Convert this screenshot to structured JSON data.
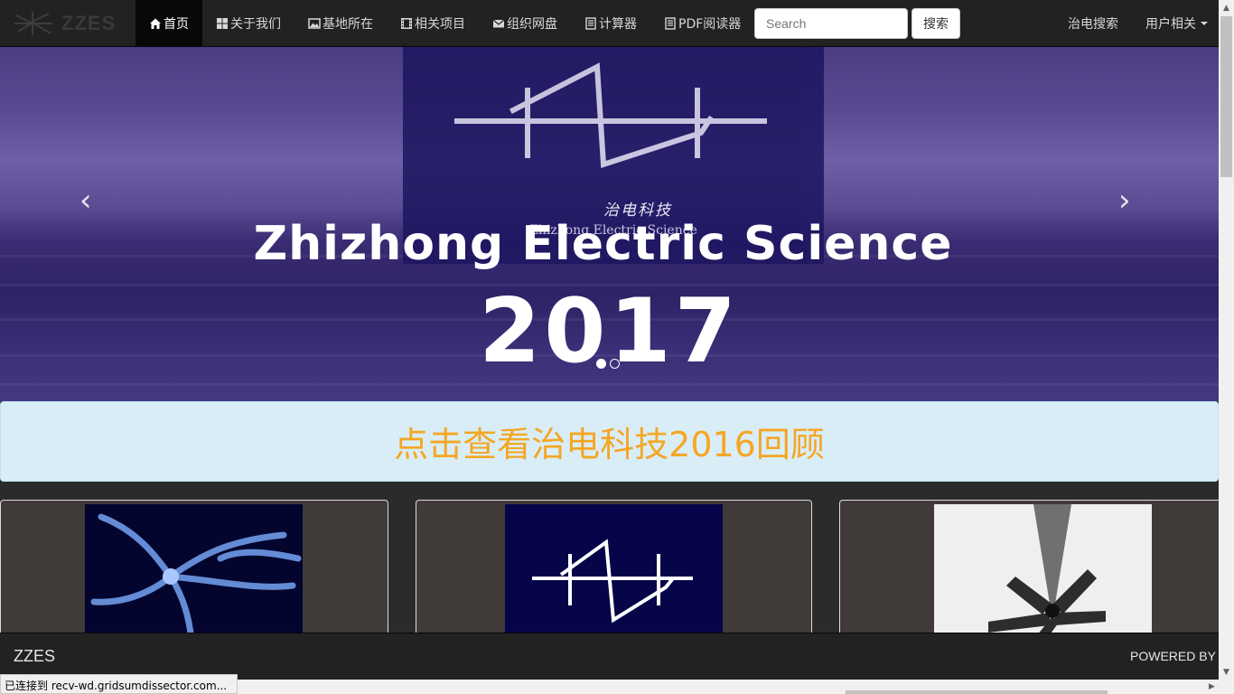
{
  "navbar": {
    "brand": "ZZES",
    "items": [
      {
        "label": "首页",
        "icon": "home-icon",
        "active": true
      },
      {
        "label": "关于我们",
        "icon": "grid-icon"
      },
      {
        "label": "基地所在",
        "icon": "picture-icon"
      },
      {
        "label": "相关项目",
        "icon": "film-icon"
      },
      {
        "label": "组织网盘",
        "icon": "envelope-icon"
      },
      {
        "label": "计算器",
        "icon": "list-icon"
      },
      {
        "label": "PDF阅读器",
        "icon": "list-icon"
      }
    ],
    "search_placeholder": "Search",
    "search_button": "搜索",
    "right_link": "治电搜索",
    "user_menu": "用户相关"
  },
  "carousel": {
    "title": "Zhizhong Electric Science",
    "year": "2017",
    "logo_cn": "治电科技",
    "logo_en": "Zhizhong Electric Science",
    "prev": "‹",
    "next": "›",
    "slides": 2,
    "active_slide": 1
  },
  "banner": {
    "text": "点击查看治电科技2016回顾",
    "text_color": "#f5a623"
  },
  "thumbnails": [
    "neuron-image",
    "logo-image",
    "device-image"
  ],
  "footer": {
    "brand": "ZZES",
    "powered": "POWERED BY"
  },
  "statusbar": {
    "text": "已连接到 recv-wd.gridsumdissector.com..."
  }
}
